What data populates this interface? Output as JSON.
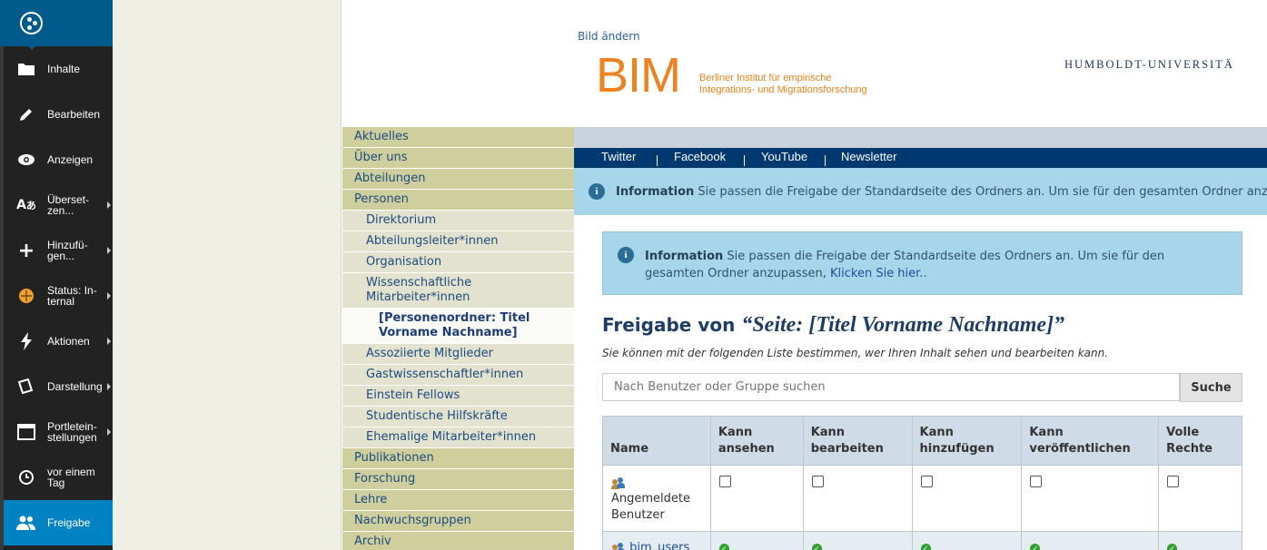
{
  "toolbar": {
    "items": [
      {
        "label": "Inhalte",
        "icon": "folder-icon"
      },
      {
        "label": "Bearbeiten",
        "icon": "pencil-icon"
      },
      {
        "label": "Anzeigen",
        "icon": "eye-icon"
      },
      {
        "label": "Überset-\nzen...",
        "icon": "translate-icon"
      },
      {
        "label": "Hinzufü-\ngen...",
        "icon": "plus-icon"
      },
      {
        "label": "Status: In-\nternal",
        "icon": "status-icon"
      },
      {
        "label": "Aktionen",
        "icon": "bolt-icon"
      },
      {
        "label": "Darstellung",
        "icon": "display-icon"
      },
      {
        "label": "Portletein-\nstellungen",
        "icon": "portlet-icon"
      },
      {
        "label": "vor einem\nTag",
        "icon": "clock-icon"
      },
      {
        "label": "Freigabe",
        "icon": "users-icon"
      }
    ]
  },
  "header": {
    "change_image": "Bild ändern",
    "logo_text": "BIM",
    "logo_sub_line1": "Berliner Institut für empirische",
    "logo_sub_line2": "Integrations- und Migrationsforschung",
    "university": "HUMBOLDT-UNIVERSITÄ"
  },
  "nav": [
    {
      "label": "Aktuelles",
      "level": 1
    },
    {
      "label": "Über uns",
      "level": 1
    },
    {
      "label": "Abteilungen",
      "level": 1
    },
    {
      "label": "Personen",
      "level": 1
    },
    {
      "label": "Direktorium",
      "level": 2
    },
    {
      "label": "Abteilungsleiter*innen",
      "level": 2
    },
    {
      "label": "Organisation",
      "level": 2
    },
    {
      "label": "Wissenschaftliche Mitarbeiter*innen",
      "level": 2
    },
    {
      "label": "[Personenordner: Titel Vorname Nachname]",
      "level": 3
    },
    {
      "label": "Assoziierte Mitglieder",
      "level": 2
    },
    {
      "label": "Gastwissenschaftler*innen",
      "level": 2
    },
    {
      "label": "Einstein Fellows",
      "level": 2
    },
    {
      "label": "Studentische Hilfskräfte",
      "level": 2
    },
    {
      "label": "Ehemalige Mitarbeiter*innen",
      "level": 2
    },
    {
      "label": "Publikationen",
      "level": 1
    },
    {
      "label": "Forschung",
      "level": 1
    },
    {
      "label": "Lehre",
      "level": 1
    },
    {
      "label": "Nachwuchsgruppen",
      "level": 1
    },
    {
      "label": "Archiv",
      "level": 1
    }
  ],
  "social": [
    "Twitter",
    "Facebook",
    "YouTube",
    "Newsletter"
  ],
  "info_top": {
    "label": "Information",
    "text": "Sie passen die Freigabe der Standardseite des Ordners an. Um sie für den gesamten Ordner anzupassen, Klicken Sie hier."
  },
  "info_box": {
    "label": "Information",
    "text": "Sie passen die Freigabe der Standardseite des Ordners an. Um sie für den gesamten Ordner anzupassen,",
    "link": "Klicken Sie hier.",
    "after": "."
  },
  "sharing": {
    "title_prefix": "Freigabe von",
    "title_item": "“Seite: [Titel Vorname Nachname]”",
    "description": "Sie können mit der folgenden Liste bestimmen, wer Ihren Inhalt sehen und bearbeiten kann.",
    "search_placeholder": "Nach Benutzer oder Gruppe suchen",
    "search_button": "Suche",
    "columns": [
      "Name",
      "Kann ansehen",
      "Kann bearbeiten",
      "Kann hinzufügen",
      "Kann veröffentlichen",
      "Volle Rechte"
    ],
    "rows": [
      {
        "name": "Angemeldete Benutzer",
        "type": "checkbox"
      },
      {
        "name": "bim_users",
        "type": "granted"
      }
    ]
  },
  "colors": {
    "toolbar_bg": "#222222",
    "toolbar_active": "#0082c3",
    "logo_orange": "#f0821e",
    "nav_level1": "#cfcf9e",
    "social_bar": "#003870",
    "info_bg": "#a7d6ea"
  }
}
